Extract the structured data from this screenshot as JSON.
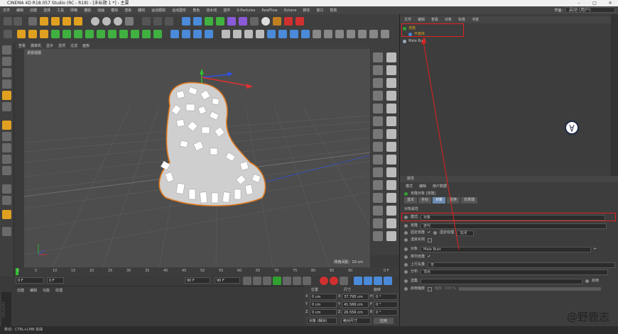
{
  "window": {
    "title": "CINEMA 4D R18.057 Studio (RC - R18) - [未标题 1 *] - 主要"
  },
  "menubar": {
    "items": [
      "文件",
      "编辑",
      "创建",
      "选择",
      "工具",
      "网格",
      "捕捉",
      "动画",
      "模拟",
      "渲染",
      "雕刻",
      "运动跟踪",
      "运动图形",
      "角色",
      "流水线",
      "插件",
      "X-Particles",
      "RealFlow",
      "Octane",
      "脚本",
      "窗口",
      "帮助"
    ],
    "layout_label": "界面:",
    "layout_value": "启动 (用户)"
  },
  "viewport": {
    "menu": [
      "查看",
      "摄像机",
      "显示",
      "选项",
      "过滤",
      "面板"
    ],
    "label": "透视视图",
    "grid_info": "网格间距：10 cm"
  },
  "timeline": {
    "ticks": [
      "0",
      "5",
      "10",
      "15",
      "20",
      "25",
      "30",
      "35",
      "40",
      "45",
      "50",
      "55",
      "60",
      "65",
      "70",
      "75",
      "80",
      "85",
      "90"
    ],
    "end_label": "0 F",
    "start_field": "0 F",
    "current_field": "0 F",
    "end_field": "90 F",
    "end_field2": "90 F"
  },
  "material_panel": {
    "tabs": [
      "创建",
      "编辑",
      "功能",
      "纹理"
    ]
  },
  "coordinates": {
    "headers": [
      "位置",
      "尺寸",
      "旋转"
    ],
    "rows": [
      {
        "axis": "X",
        "pos": "0 cm",
        "size_axis": "X",
        "size": "37.795 cm",
        "rot_axis": "H",
        "rot": "0 °"
      },
      {
        "axis": "Y",
        "pos": "0 cm",
        "size_axis": "Y",
        "size": "41.566 cm",
        "rot_axis": "P",
        "rot": "0 °"
      },
      {
        "axis": "Z",
        "pos": "0 cm",
        "size_axis": "Z",
        "size": "26.556 cm",
        "rot_axis": "B",
        "rot": "0 °"
      }
    ],
    "mode_select": "对象 (相对)",
    "size_select": "绝对尺寸",
    "apply_button": "应用"
  },
  "status": {
    "text": "移动：CTRL+LMB 拆曲"
  },
  "object_manager": {
    "menu": [
      "文件",
      "编辑",
      "查看",
      "对象",
      "标签",
      "书签"
    ],
    "objects": [
      {
        "name": "克隆",
        "color": "#e0a020"
      },
      {
        "name": "平面体",
        "color": "#e0a020"
      },
      {
        "name": "Male Bust",
        "color": "#c8c8c8"
      }
    ]
  },
  "attributes": {
    "header": "属性",
    "submenu": [
      "模式",
      "编辑",
      "用户数据"
    ],
    "object_title": "克隆对象 [克隆]",
    "tabs": [
      "基本",
      "坐标",
      "对象",
      "变换",
      "效果器"
    ],
    "active_tab": "对象",
    "section_title": "对象属性",
    "mode_label": "模式",
    "mode_value": "对象",
    "clones_label": "克隆",
    "clones_value": "迭代",
    "fix_clone_label": "固定克隆",
    "fix_texture_label": "固定纹理",
    "fix_texture_value": "关闭",
    "render_instances_label": "渲染实例",
    "object_label": "对象",
    "object_value": "Male Bust",
    "arrange_label": "排列克隆",
    "up_vector_label": "上行矢量",
    "up_vector_value": "无",
    "distribution_label": "分布",
    "distribution_value": "顶点",
    "selection_label": "选集",
    "enable_label": "启用",
    "scale_label": "启用缩放",
    "scale_sub": "缩放",
    "scale_value": "100 %"
  },
  "watermark": {
    "text": "@野鹿志",
    "logo_text": "野鹿志"
  },
  "colors": {
    "highlight_red": "#e02020",
    "gizmo_x": "#e03030",
    "gizmo_y": "#30c030",
    "gizmo_z": "#3050e0",
    "tab_active": "#6a8ab0"
  }
}
